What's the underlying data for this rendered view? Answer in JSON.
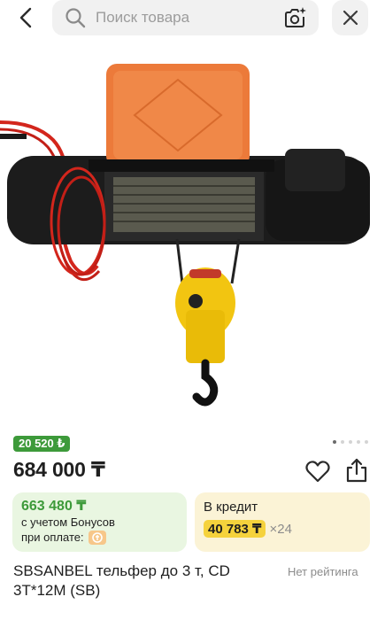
{
  "search": {
    "placeholder": "Поиск товара"
  },
  "badge": {
    "bonus_amount": "20 520 ₺"
  },
  "gallery": {
    "total": 5,
    "active": 1
  },
  "product": {
    "price": "684 000 ₸",
    "title": "SBSANBEL тельфер до 3 т, CD 3T*12M (SB)",
    "rating_text": "Нет рейтинга"
  },
  "bonus_card": {
    "amount": "663 480 ₸",
    "line1": "с учетом Бонусов",
    "line2": "при оплате:"
  },
  "credit_card": {
    "title": "В кредит",
    "monthly": "40 783 ₸",
    "term": "×24"
  },
  "colors": {
    "accent_green": "#3d9a3a",
    "bonus_bg": "#e9f6e1",
    "credit_bg": "#fbf3d6",
    "credit_highlight": "#f5d23c"
  },
  "icons": [
    "back-arrow-icon",
    "search-icon",
    "camera-sparkle-icon",
    "close-icon",
    "heart-icon",
    "share-icon",
    "bonus-icon"
  ]
}
